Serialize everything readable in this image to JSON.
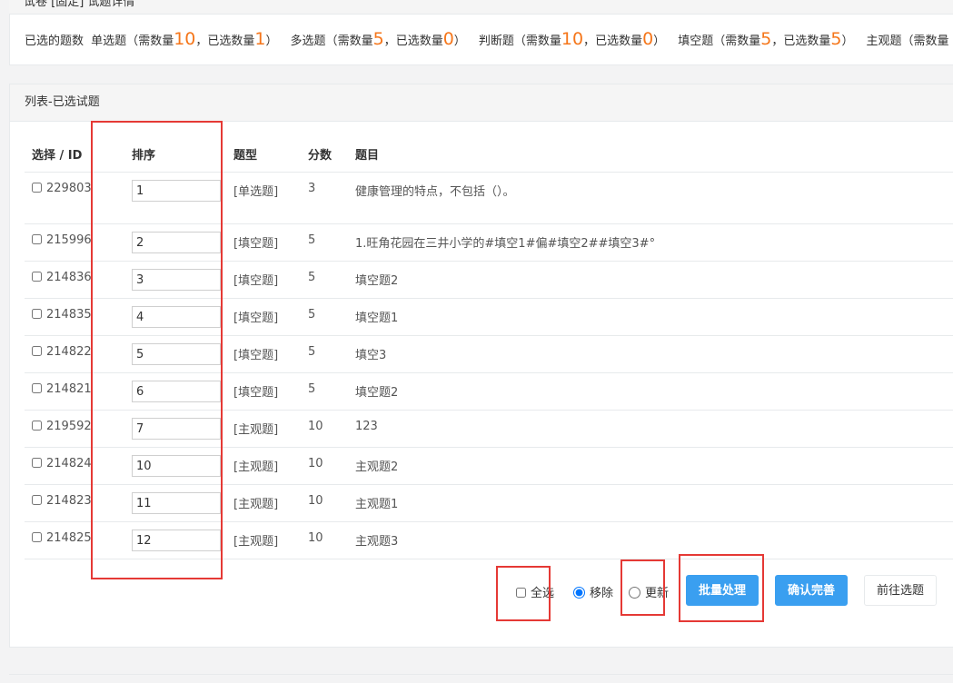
{
  "top": {
    "clipped_title": "试卷 [固定] 试题详情"
  },
  "summary": {
    "label": "已选的题数",
    "segments": [
      {
        "type": "单选题",
        "need": "10",
        "chosen": "1"
      },
      {
        "type": "多选题",
        "need": "5",
        "chosen": "0"
      },
      {
        "type": "判断题",
        "need": "10",
        "chosen": "0"
      },
      {
        "type": "填空题",
        "need": "5",
        "chosen": "5"
      },
      {
        "type": "主观题",
        "need": "",
        "chosen": ""
      }
    ],
    "need_label": "需数量",
    "chosen_label": "已选数量"
  },
  "panel": {
    "title": "列表-已选试题"
  },
  "table": {
    "headers": [
      "选择 / ID",
      "排序",
      "题型",
      "分数",
      "题目"
    ],
    "rows": [
      {
        "id": "229803",
        "order": "1",
        "type": "[单选题]",
        "score": "3",
        "title": "健康管理的特点，不包括（）。"
      },
      {
        "id": "215996",
        "order": "2",
        "type": "[填空题]",
        "score": "5",
        "title": "1.旺角花园在三井小学的#填空1#偏#填空2##填空3#°"
      },
      {
        "id": "214836",
        "order": "3",
        "type": "[填空题]",
        "score": "5",
        "title": "填空题2"
      },
      {
        "id": "214835",
        "order": "4",
        "type": "[填空题]",
        "score": "5",
        "title": "填空题1"
      },
      {
        "id": "214822",
        "order": "5",
        "type": "[填空题]",
        "score": "5",
        "title": "填空3"
      },
      {
        "id": "214821",
        "order": "6",
        "type": "[填空题]",
        "score": "5",
        "title": "填空题2"
      },
      {
        "id": "219592",
        "order": "7",
        "type": "[主观题]",
        "score": "10",
        "title": "123"
      },
      {
        "id": "214824",
        "order": "10",
        "type": "[主观题]",
        "score": "10",
        "title": "主观题2"
      },
      {
        "id": "214823",
        "order": "11",
        "type": "[主观题]",
        "score": "10",
        "title": "主观题1"
      },
      {
        "id": "214825",
        "order": "12",
        "type": "[主观题]",
        "score": "10",
        "title": "主观题3"
      }
    ]
  },
  "footer": {
    "select_all": "全选",
    "remove": "移除",
    "update": "更新",
    "batch": "批量处理",
    "confirm": "确认完善",
    "goto": "前往选题"
  },
  "colors": {
    "accent": "#3a9ff0",
    "highlight": "#e53935",
    "number": "#f5761a"
  }
}
